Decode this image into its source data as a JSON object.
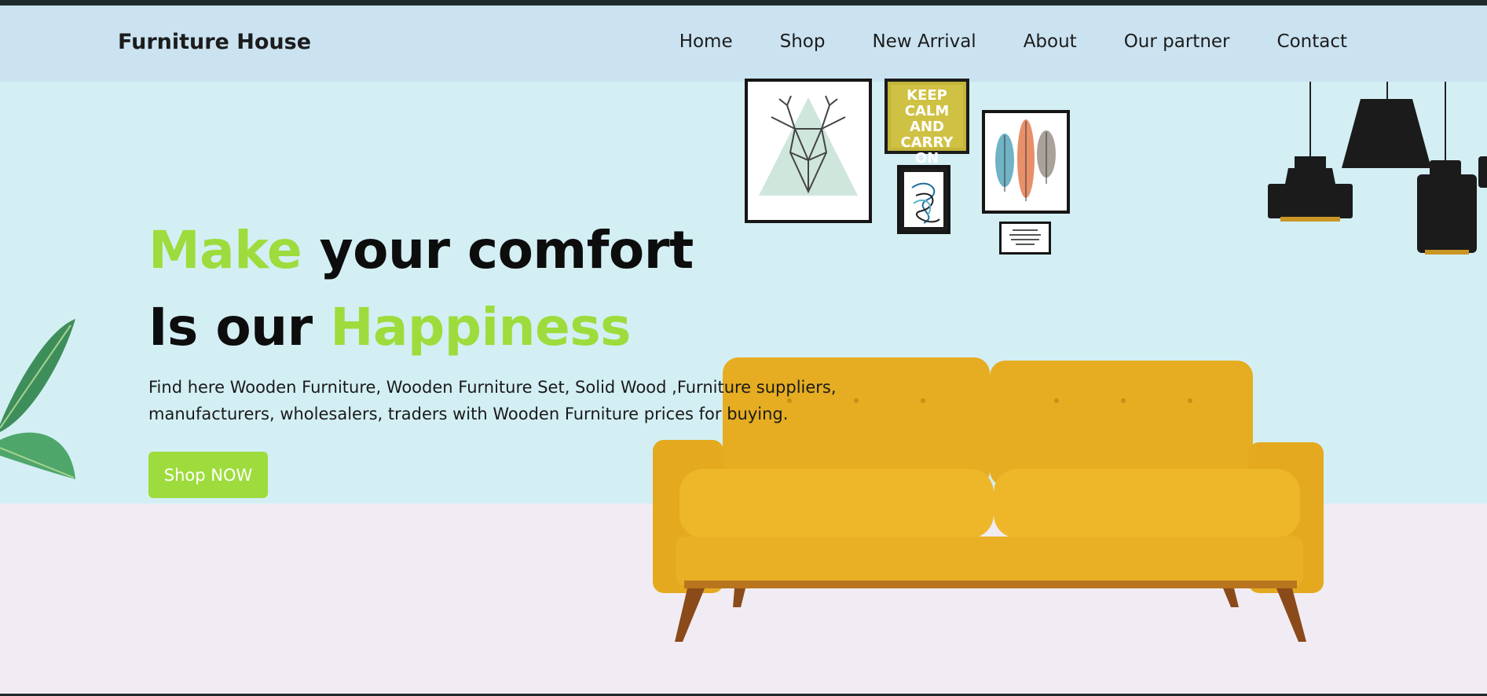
{
  "brand": {
    "name": "Furniture House"
  },
  "nav": {
    "items": [
      {
        "label": "Home"
      },
      {
        "label": "Shop"
      },
      {
        "label": "New Arrival"
      },
      {
        "label": "About"
      },
      {
        "label": "Our partner"
      },
      {
        "label": "Contact"
      }
    ]
  },
  "hero": {
    "line1_accent": "Make",
    "line1_rest": " your comfort",
    "line2_start": "Is our ",
    "line2_accent": "Happiness",
    "description": "Find here Wooden Furniture, Wooden Furniture Set, Solid Wood ,Furniture suppliers, manufacturers, wholesalers, traders with Wooden Furniture prices for buying.",
    "cta_label": "Shop NOW"
  },
  "wall_art": {
    "keep_calm_text": "KEEP CALM AND CARRY ON"
  },
  "colors": {
    "accent": "#9ddc3c",
    "navbar_bg": "#cbe3f1",
    "hero_bg": "#d3eff4",
    "floor_bg": "#f1ecf3",
    "sofa": "#e8b22a"
  },
  "icons": {
    "sofa": "sofa-illustration",
    "lamps": "pendant-lamps-illustration",
    "plant": "plant-leaves-illustration",
    "deer_frame": "deer-frame-art"
  }
}
